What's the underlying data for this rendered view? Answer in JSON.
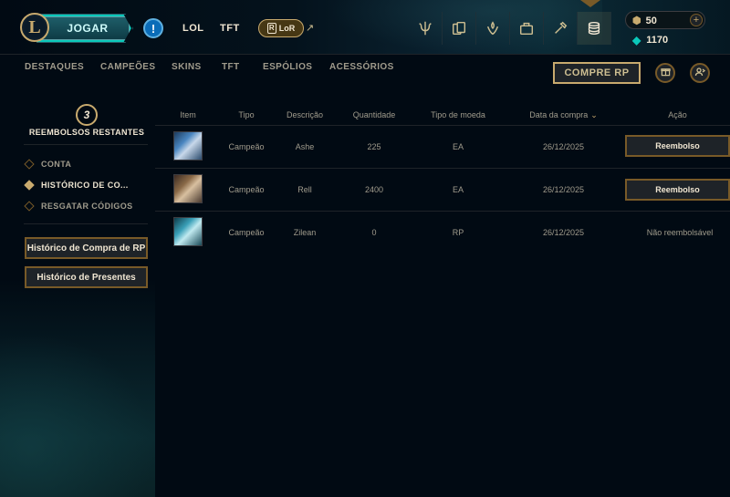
{
  "topbar": {
    "logo_letter": "L",
    "play_label": "JOGAR",
    "alert_symbol": "!",
    "nav": [
      {
        "label": "LOL"
      },
      {
        "label": "TFT"
      }
    ],
    "lor_badge": "R",
    "lor_label": "LoR",
    "external_symbol": "↗",
    "icons": [
      "tft-trophy-icon",
      "collection-icon",
      "loot-icon",
      "inventory-icon",
      "crafting-icon",
      "store-icon"
    ],
    "currency": {
      "rp": "50",
      "blue_essence": "1170",
      "plus_symbol": "+"
    }
  },
  "subnav": {
    "items": [
      {
        "label": "DESTAQUES"
      },
      {
        "label": "CAMPEÕES"
      },
      {
        "label": "SKINS"
      },
      {
        "label": "TFT"
      },
      {
        "label": "ESPÓLIOS"
      },
      {
        "label": "ACESSÓRIOS"
      }
    ],
    "buy_rp": "COMPRE RP"
  },
  "sidebar": {
    "refund_count": "3",
    "refund_label": "REEMBOLSOS RESTANTES",
    "items": [
      {
        "label": "CONTA",
        "active": false
      },
      {
        "label": "HISTÓRICO DE CO...",
        "active": true
      },
      {
        "label": "RESGATAR CÓDIGOS",
        "active": false
      }
    ],
    "rp_history_btn": "Histórico de Compra de RP",
    "gift_history_btn": "Histórico de Presentes"
  },
  "table": {
    "headers": {
      "item": "Item",
      "type": "Tipo",
      "description": "Descrição",
      "quantity": "Quantidade",
      "currency": "Tipo de moeda",
      "date": "Data da compra",
      "action": "Ação"
    },
    "sort_symbol": "⌄",
    "rows": [
      {
        "type": "Campeão",
        "description": "Ashe",
        "quantity": "225",
        "currency": "EA",
        "date": "26/12/2025",
        "action": "Reembolso",
        "refundable": true
      },
      {
        "type": "Campeão",
        "description": "Rell",
        "quantity": "2400",
        "currency": "EA",
        "date": "26/12/2025",
        "action": "Reembolso",
        "refundable": true
      },
      {
        "type": "Campeão",
        "description": "Zilean",
        "quantity": "0",
        "currency": "RP",
        "date": "26/12/2025",
        "action": "Não reembolsável",
        "refundable": false
      }
    ]
  },
  "colors": {
    "gold": "#c8aa6e",
    "gold_dark": "#785a28",
    "text_light": "#f0e6d2",
    "text_muted": "#a09b8c",
    "teal": "#0ac8b9",
    "background": "#010a13"
  }
}
